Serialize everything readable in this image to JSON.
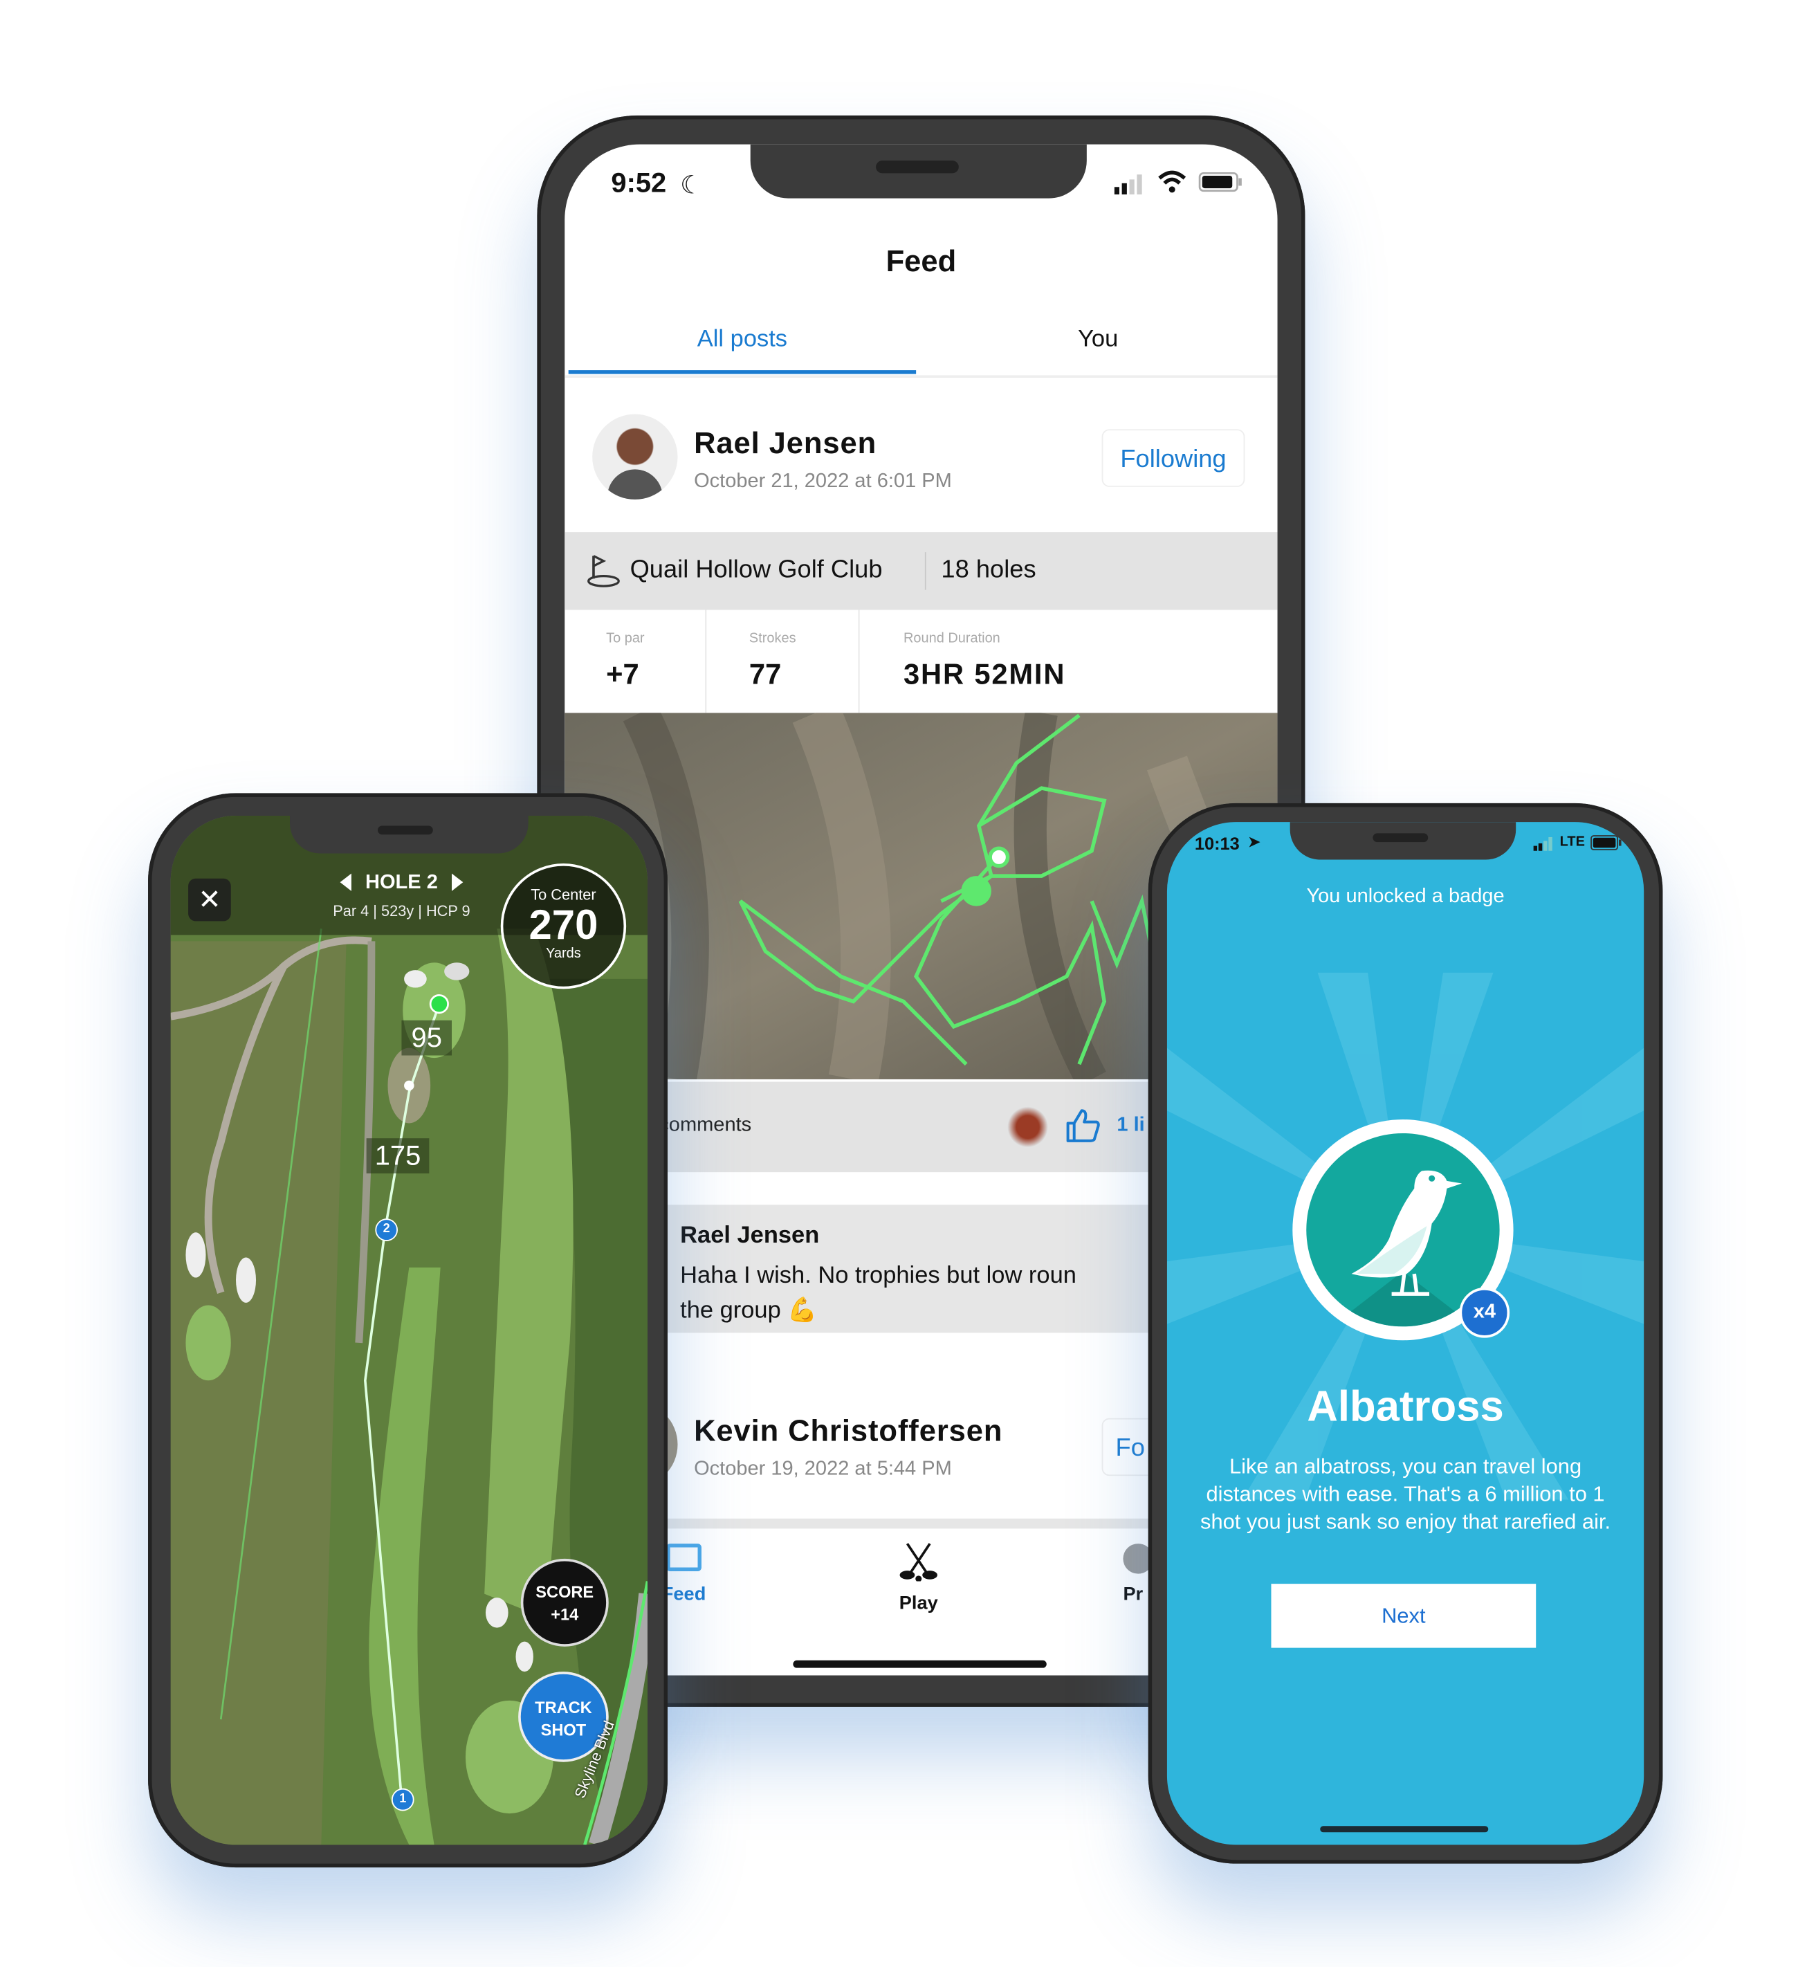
{
  "feed_phone": {
    "status": {
      "time": "9:52"
    },
    "title": "Feed",
    "tabs": [
      {
        "label": "All posts",
        "active": true
      },
      {
        "label": "You",
        "active": false
      }
    ],
    "post": {
      "author": "Rael Jensen",
      "date": "October 21, 2022 at 6:01 PM",
      "follow_label": "Following",
      "course": "Quail Hollow Golf Club",
      "holes": "18 holes",
      "stats": [
        {
          "label": "To par",
          "value": "+7"
        },
        {
          "label": "Strokes",
          "value": "77"
        },
        {
          "label": "Round Duration",
          "value": "3HR 52MIN"
        }
      ],
      "comments_label": "comments",
      "likes_label": "1 li"
    },
    "comment": {
      "author": "Rael Jensen",
      "line1": "Haha I wish. No trophies but low roun",
      "line2": "the group 💪"
    },
    "next_post": {
      "author": "Kevin Christoffersen",
      "date": "October 19, 2022 at 5:44 PM",
      "follow_label": "Fo"
    },
    "nav": [
      {
        "label": "Feed",
        "icon": "feed-icon",
        "active": true
      },
      {
        "label": "Play",
        "icon": "golf-clubs-icon"
      },
      {
        "label": "Pr",
        "icon": "profile-icon"
      }
    ],
    "accent": "#1a7bd0"
  },
  "gps_phone": {
    "hole": "HOLE 2",
    "hole_info": "Par 4 | 523y | HCP 9",
    "to_center_label": "To Center",
    "to_center_value": "270",
    "to_center_unit": "Yards",
    "distances": [
      "95",
      "175"
    ],
    "markers": [
      "2",
      "1"
    ],
    "score_label": "SCORE",
    "score_value": "+14",
    "track_label_1": "TRACK",
    "track_label_2": "SHOT",
    "road_label": "Skyline Blvd",
    "track_color": "#1f7bd6"
  },
  "badge_phone": {
    "status": {
      "time": "10:13",
      "network": "LTE"
    },
    "header": "You unlocked a badge",
    "badge_count": "x4",
    "badge_name": "Albatross",
    "description": "Like an albatross, you can travel long distances with ease. That's a 6 million to 1 shot you just sank so enjoy that rarefied air.",
    "next_label": "Next",
    "background": "#2fb5dc",
    "badge_color": "#13a89e"
  }
}
